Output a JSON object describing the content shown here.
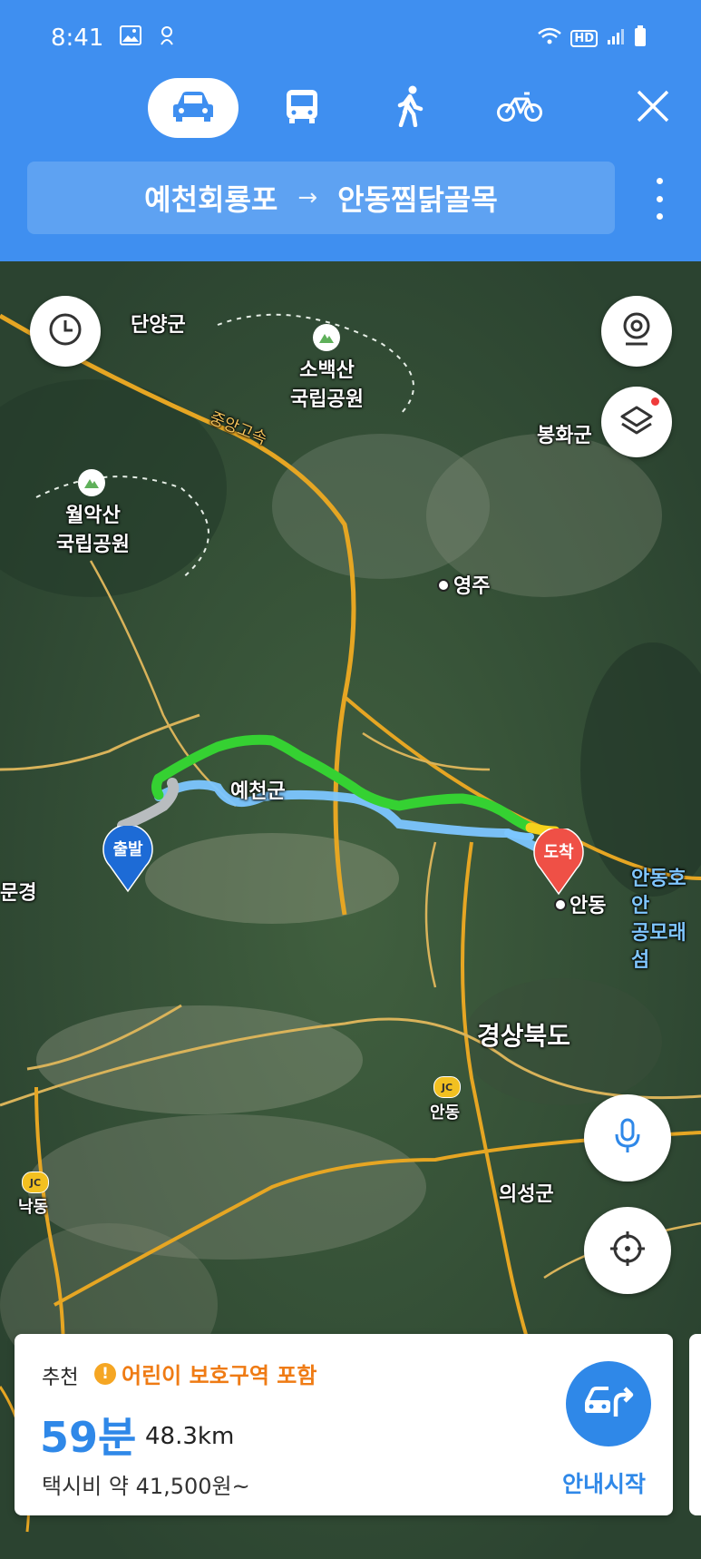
{
  "status_bar": {
    "time": "8:41",
    "network": "HD"
  },
  "modes": [
    {
      "name": "car",
      "active": true
    },
    {
      "name": "bus",
      "active": false
    },
    {
      "name": "walk",
      "active": false
    },
    {
      "name": "bike",
      "active": false
    }
  ],
  "route": {
    "origin": "예천회룡포",
    "arrow": "→",
    "destination": "안동찜닭골목"
  },
  "map": {
    "labels": {
      "danyang": "단양군",
      "sobaeksan": "소백산\n국립공원",
      "woraksan": "월악산\n국립공원",
      "bonghwa": "봉화군",
      "yeongju": "영주",
      "yecheon": "예천군",
      "mungyeong": "문경",
      "andong_city": "안동",
      "andong_lake": "안동호안\n공모래섬",
      "gyeongbuk": "경상북도",
      "andong_jc": "안동",
      "nakdong": "낙동",
      "uiseong": "의성군",
      "expressway": "중앙고속"
    },
    "start_pin": "출발",
    "end_pin": "도착",
    "jc_badge": "JC"
  },
  "summary": {
    "tag": "추천",
    "warning": "어린이 보호구역 포함",
    "duration": "59분",
    "distance": "48.3km",
    "taxi_fare": "택시비 약 41,500원~",
    "start_label": "안내시작"
  },
  "colors": {
    "header": "#3f8ff0",
    "accent": "#2f88e8",
    "warning": "#ef7b14",
    "route_main": "#35d132",
    "route_alt": "#7cc6ff"
  }
}
